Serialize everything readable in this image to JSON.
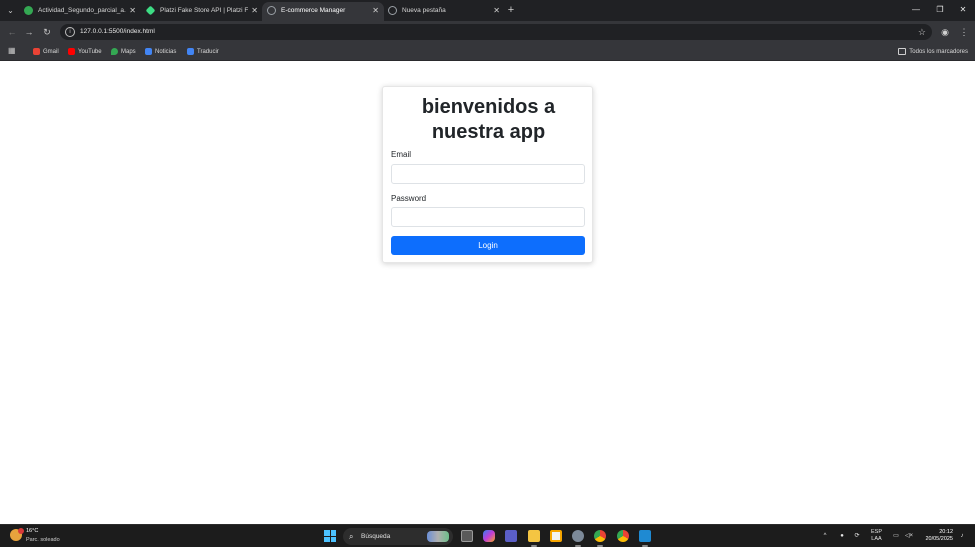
{
  "browser": {
    "tabs": [
      {
        "title": "Actividad_Segundo_parcial_a.p",
        "favicon_color": "#34a853"
      },
      {
        "title": "Platzi Fake Store API | Platzi Fak",
        "favicon_color": "#3ddc84"
      },
      {
        "title": "E-commerce Manager",
        "favicon_color": "#9aa0a6",
        "active": true
      },
      {
        "title": "Nueva pestaña",
        "favicon_color": "#9aa0a6"
      }
    ],
    "address_url": "127.0.0.1:5500/index.html",
    "bookmarks": [
      {
        "label": "Gmail",
        "color": "#ea4335"
      },
      {
        "label": "YouTube",
        "color": "#ff0000"
      },
      {
        "label": "Maps",
        "color": "#34a853"
      },
      {
        "label": "Noticias",
        "color": "#4285f4"
      },
      {
        "label": "Traducir",
        "color": "#4285f4"
      }
    ],
    "all_bookmarks_label": "Todos los marcadores"
  },
  "app": {
    "heading_line1": "bienvenidos a",
    "heading_line2": "nuestra app",
    "email_label": "Email",
    "email_value": "",
    "password_label": "Password",
    "password_value": "",
    "login_label": "Login",
    "accent": "#0d6efd"
  },
  "taskbar": {
    "weather_temp": "16°C",
    "weather_desc": "Parc. soleado",
    "search_placeholder": "Búsqueda",
    "lang_top": "ESP",
    "lang_bottom": "LAA",
    "time": "20:12",
    "date": "20/05/2025"
  }
}
